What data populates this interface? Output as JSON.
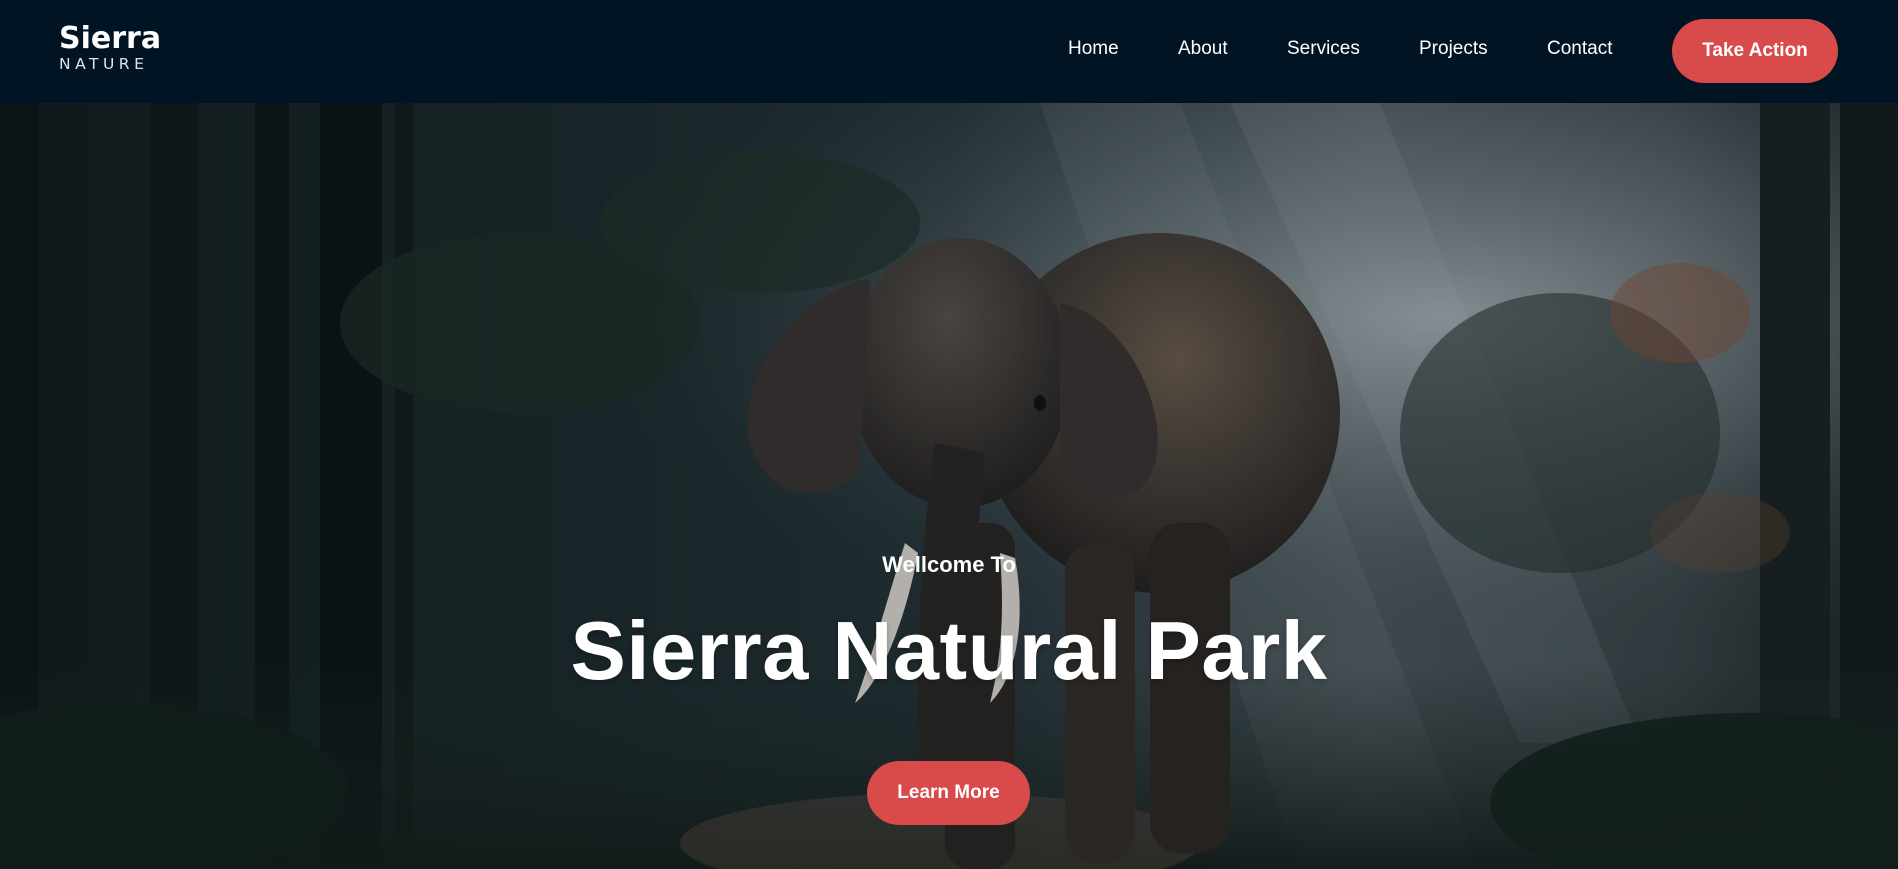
{
  "brand": {
    "name": "Sierra",
    "tagline": "NATURE"
  },
  "nav": {
    "items": [
      {
        "label": "Home"
      },
      {
        "label": "About"
      },
      {
        "label": "Services"
      },
      {
        "label": "Projects"
      },
      {
        "label": "Contact"
      }
    ],
    "cta_label": "Take Action"
  },
  "hero": {
    "welcome": "Wellcome To",
    "title": "Sierra Natural Park",
    "button_label": "Learn More",
    "image": "elephant-in-misty-forest"
  },
  "colors": {
    "header_bg": "#011424",
    "accent": "#d94a4b",
    "text": "#ffffff"
  }
}
